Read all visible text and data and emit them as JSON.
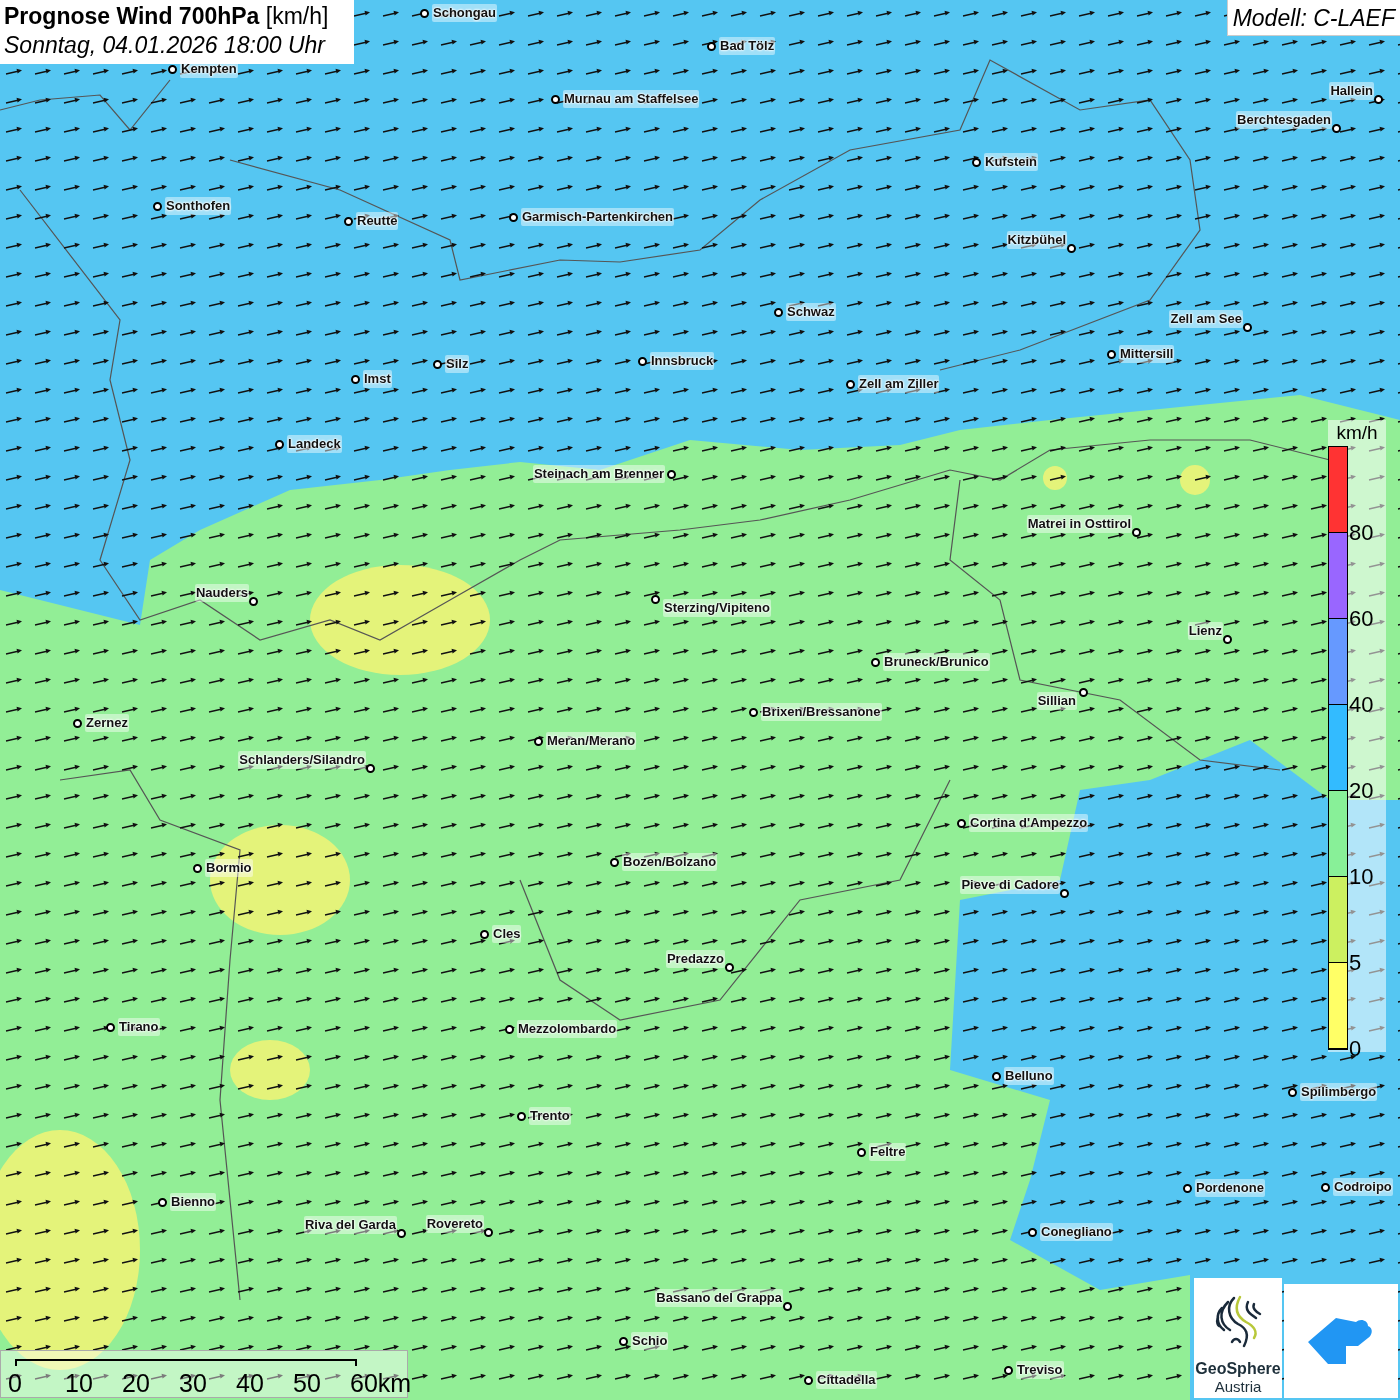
{
  "title": "**Prognose Wind 700hPa** [km/h]",
  "subtitle": "Sonntag, 04.01.2026 18:00 Uhr",
  "model": "Modell: C-LAEF",
  "cities": [
    "Schongau",
    "Bad Tölz",
    "Kempten",
    "Murnau am Staffelsee",
    "Hallein",
    "Berchtesgaden",
    "Kufstein",
    "Sonthofen",
    "Reutte",
    "Garmisch-Partenkirchen",
    "Kitzbühel",
    "Schwaz",
    "Zell am See",
    "Mittersill",
    "Innsbruck",
    "Silz",
    "Imst",
    "Zell am Ziller",
    "Landeck",
    "Steinach am Brenner",
    "Matrei in Osttirol",
    "Nauders",
    "Sterzing/Vipiteno",
    "Lienz",
    "Bruneck/Brunico",
    "Sillian",
    "Brixen/Bressanone",
    "Zernez",
    "Meran/Merano",
    "Schlanders/Silandro",
    "Cortina d'Ampezzo",
    "Bozen/Bolzano",
    "Bormio",
    "Pieve di Cadore",
    "Cles",
    "Predazzo",
    "Tirano",
    "Mezzolombardo",
    "Belluno",
    "Spilimbergo",
    "Trento",
    "Feltre",
    "Pordenone",
    "Codroipo",
    "Bienno",
    "Riva del Garda",
    "Rovereto",
    "Conegliano",
    "Bassano del Grappa",
    "Schio",
    "Treviso",
    "Cittadella"
  ],
  "legend": {
    "unit": "km/h",
    "classes": [
      {
        "label": "80",
        "color": "#ff3333"
      },
      {
        "label": "60",
        "color": "#9966ff"
      },
      {
        "label": "40",
        "color": "#6699ff"
      },
      {
        "label": "20",
        "color": "#33bbff"
      },
      {
        "label": "10",
        "color": "#88f098"
      },
      {
        "label": "5",
        "color": "#ccf060"
      },
      {
        "label": "0",
        "color": "#ffff66"
      }
    ]
  },
  "scale_bar": [
    "0",
    "10",
    "20",
    "30",
    "40",
    "50",
    "60km"
  ],
  "logo": {
    "name": "GeoSphere",
    "sub": "Austria"
  }
}
